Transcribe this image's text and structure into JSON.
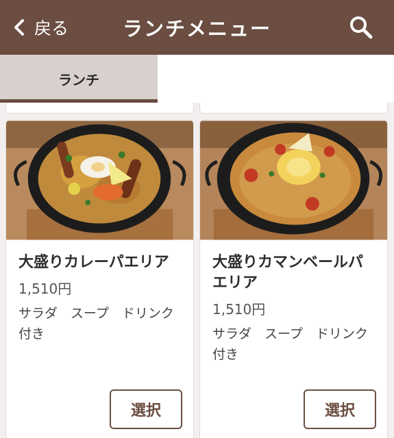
{
  "header": {
    "back_label": "戻る",
    "title": "ランチメニュー",
    "background_color": "#6b4d41"
  },
  "tabs": [
    {
      "label": "ランチ",
      "selected": true
    }
  ],
  "menu": {
    "items": [
      {
        "name": "大盛りカレーパエリア",
        "price": "1,510円",
        "description": "サラダ　スープ　ドリンク付き",
        "button_label": "選択"
      },
      {
        "name": "大盛りカマンベールパエリア",
        "price": "1,510円",
        "description": "サラダ　スープ　ドリンク付き",
        "button_label": "選択"
      }
    ]
  },
  "icons": {
    "back": "chevron-left-icon",
    "search": "search-icon"
  }
}
